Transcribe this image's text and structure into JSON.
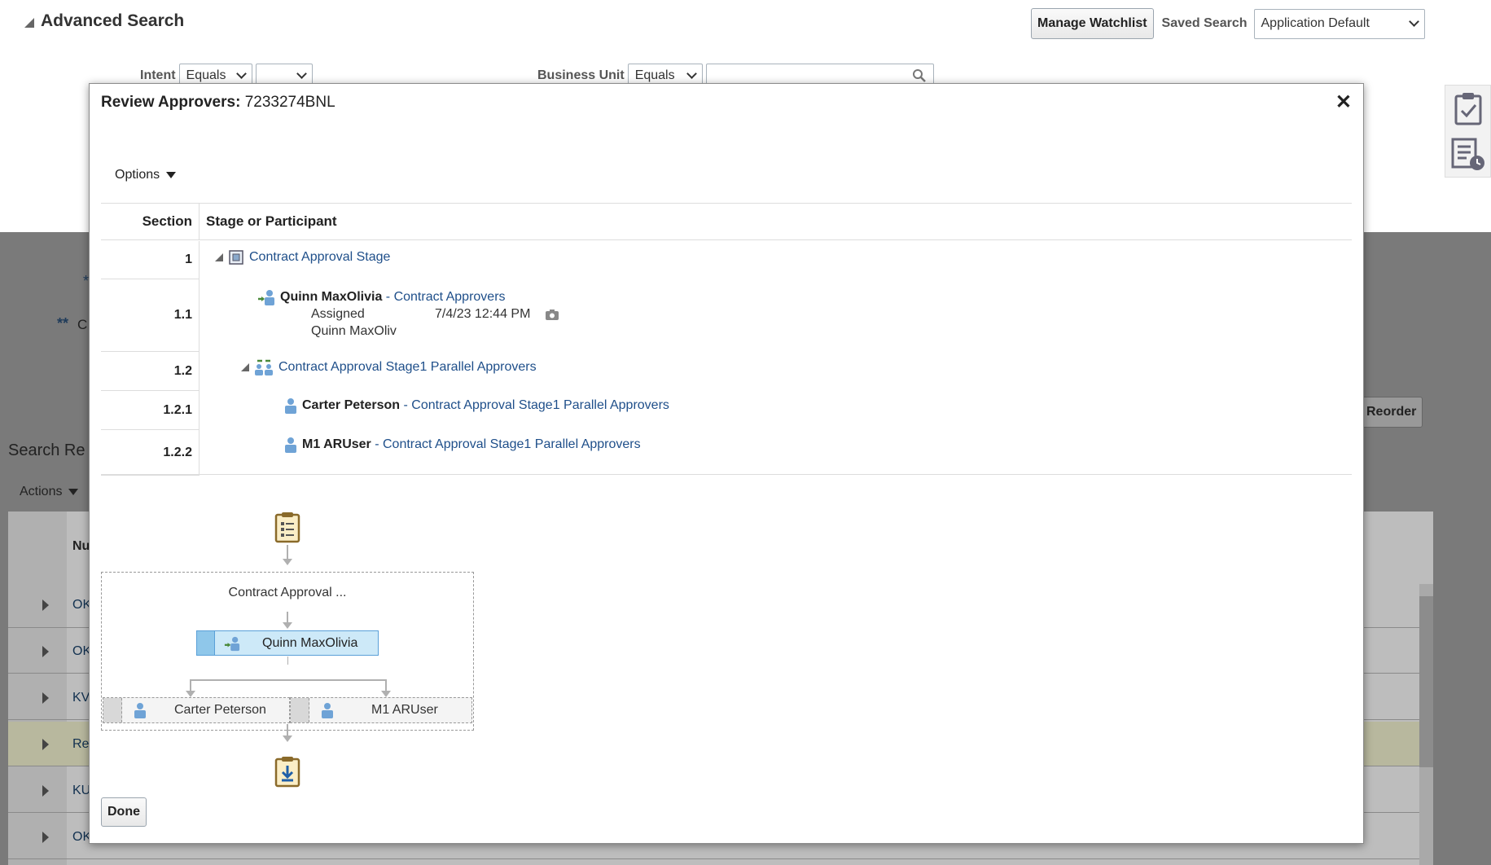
{
  "background": {
    "title": "Advanced Search",
    "manage_watchlist": "Manage Watchlist",
    "saved_search_label": "Saved Search",
    "saved_search_value": "Application Default",
    "intent_label": "Intent",
    "intent_operator": "Equals",
    "business_unit_label": "Business Unit",
    "business_unit_operator": "Equals",
    "required_marker_1": "*",
    "required_marker_2": "**",
    "partial_text": "C",
    "search_results_label": "Search Re",
    "actions_label": "Actions",
    "reorder_label": "Reorder",
    "column_partial": "Nu",
    "row_partials": [
      "OK",
      "OK",
      "KV",
      "Re",
      "KU",
      "OK"
    ]
  },
  "modal": {
    "title_label": "Review Approvers:",
    "title_value": "7233274BNL",
    "close": "✕",
    "options_label": "Options",
    "columns": {
      "section": "Section",
      "stage": "Stage or Participant"
    },
    "rows": [
      {
        "section": "1",
        "link": "Contract Approval Stage"
      },
      {
        "section": "1.1",
        "name": "Quinn MaxOlivia",
        "sep": " - ",
        "link": "Contract Approvers",
        "status": "Assigned",
        "date": "7/4/23 12:44 PM",
        "assignee": "Quinn MaxOliv"
      },
      {
        "section": "1.2",
        "link": "Contract Approval Stage1 Parallel Approvers"
      },
      {
        "section": "1.2.1",
        "name": "Carter Peterson",
        "sep": " - ",
        "link": "Contract Approval Stage1 Parallel Approvers"
      },
      {
        "section": "1.2.2",
        "name": "M1 ARUser",
        "sep": " - ",
        "link": "Contract Approval Stage1 Parallel Approvers"
      }
    ],
    "diagram": {
      "stage_label": "Contract Approval ...",
      "node_main": "Quinn MaxOlivia",
      "node_left": "Carter Peterson",
      "node_right": "M1 ARUser"
    },
    "done_label": "Done"
  }
}
